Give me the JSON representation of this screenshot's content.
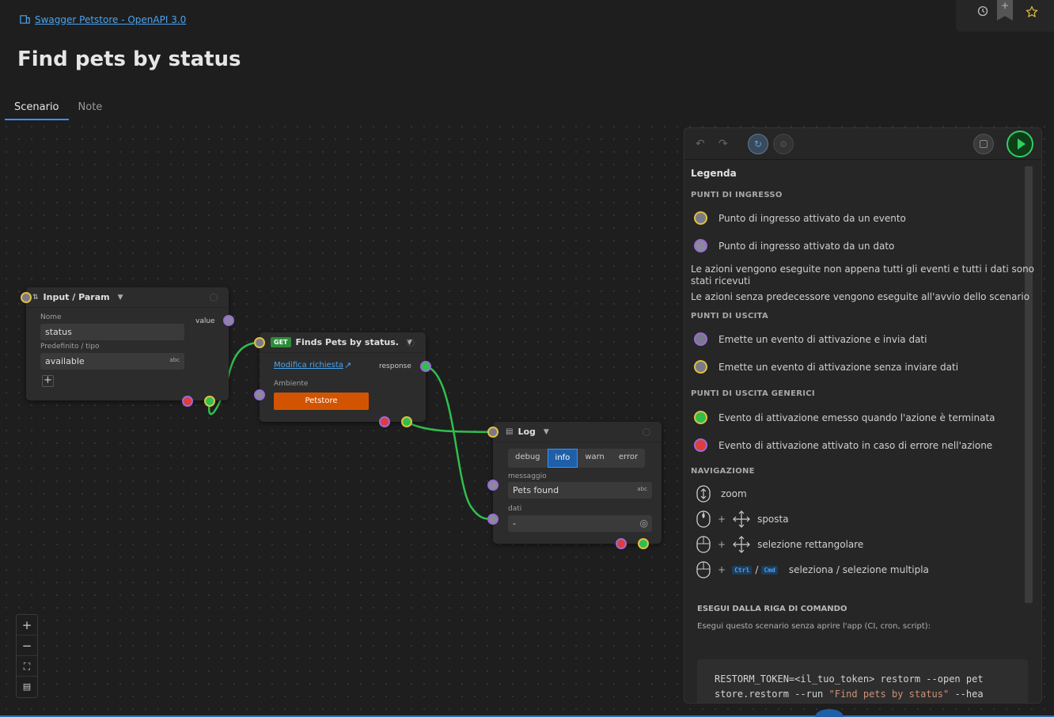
{
  "breadcrumb": {
    "label": "Swagger Petstore - OpenAPI 3.0"
  },
  "page": {
    "title": "Find pets by status"
  },
  "tabs": [
    {
      "label": "Scenario",
      "active": true
    },
    {
      "label": "Note",
      "active": false
    }
  ],
  "nodes": {
    "input": {
      "title": "Input / Param",
      "name_label": "Nome",
      "name_value": "status",
      "default_label": "Predefinito / tipo",
      "default_value": "available",
      "type_tag": "abc",
      "out_label": "value",
      "add_icon": "plus-icon"
    },
    "request": {
      "method": "GET",
      "title": "Finds Pets by status.",
      "edit_link": "Modifica richiesta",
      "out_label": "response",
      "env_label": "Ambiente",
      "env_value": "Petstore"
    },
    "log": {
      "title": "Log",
      "levels": [
        "debug",
        "info",
        "warn",
        "error"
      ],
      "selected_level": "info",
      "message_label": "messaggio",
      "message_value": "Pets found",
      "type_tag": "abc",
      "data_label": "dati",
      "data_value": "-"
    }
  },
  "zoom_controls": [
    "zoom-in-icon",
    "zoom-out-icon",
    "fit-view-icon",
    "minimap-icon"
  ],
  "legend": {
    "title": "Legenda",
    "entry_points_title": "PUNTI DI INGRESSO",
    "entry_event": "Punto di ingresso attivato da un evento",
    "entry_data": "Punto di ingresso attivato da un dato",
    "note1": "Le azioni vengono eseguite non appena tutti gli eventi e tutti i dati sono stati ricevuti",
    "note2": "Le azioni senza predecessore vengono eseguite all'avvio dello scenario",
    "exit_points_title": "PUNTI DI USCITA",
    "exit_data": "Emette un evento di attivazione e invia dati",
    "exit_nodata": "Emette un evento di attivazione senza inviare dati",
    "generic_title": "PUNTI DI USCITA GENERICI",
    "generic_ok": "Evento di attivazione emesso quando l'azione è terminata",
    "generic_err": "Evento di attivazione attivato in caso di errore nell'azione",
    "nav_title": "NAVIGAZIONE",
    "nav_zoom": "zoom",
    "nav_move": "sposta",
    "nav_rect": "selezione rettangolare",
    "nav_select": "seleziona / selezione multipla",
    "plus": "+",
    "slash": "/",
    "key_ctrl": "Ctrl",
    "key_cmd": "Cmd"
  },
  "cli": {
    "title": "ESEGUI DALLA RIGA DI COMANDO",
    "description": "Esegui questo scenario senza aprire l'app (CI, cron, script):",
    "line1": "RESTORM_TOKEN=<il_tuo_token> restorm --open pet",
    "line2_prefix": "store.restorm --run ",
    "line2_string": "\"Find pets by status\"",
    "line2_suffix": " --hea"
  },
  "colors": {
    "accent": "#3794ff",
    "event_port": "#e0c040",
    "data_port": "#9b6bd8",
    "success": "#2fbf4f",
    "error": "#e03c3c",
    "env_button": "#d35400",
    "get_badge": "#2e8b3a"
  }
}
